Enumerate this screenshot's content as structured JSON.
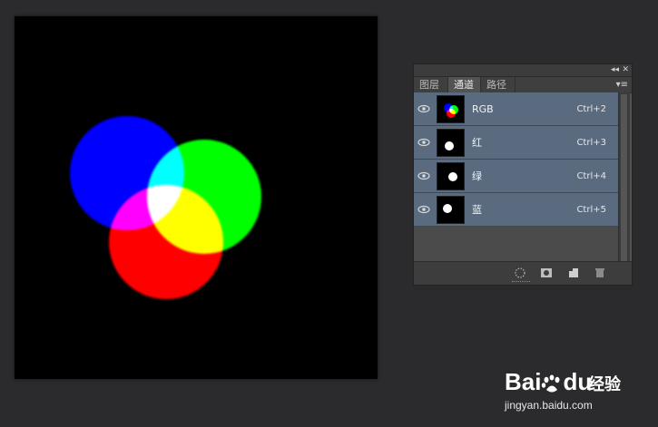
{
  "canvas": {
    "background": "#000000",
    "circles": [
      {
        "name": "blue-circle",
        "color": "#0000ff"
      },
      {
        "name": "green-circle",
        "color": "#00ff00"
      },
      {
        "name": "red-circle",
        "color": "#ff0000"
      }
    ]
  },
  "panel": {
    "controls": {
      "collapse": "◂◂",
      "close": "✕"
    },
    "tabs": [
      {
        "label": "图层",
        "active": false
      },
      {
        "label": "通道",
        "active": true
      },
      {
        "label": "路径",
        "active": false
      }
    ],
    "menu_icon": "▾≡",
    "channels": [
      {
        "name": "RGB",
        "shortcut": "Ctrl+2",
        "icon": "eye-icon"
      },
      {
        "name": "红",
        "shortcut": "Ctrl+3",
        "icon": "eye-icon"
      },
      {
        "name": "绿",
        "shortcut": "Ctrl+4",
        "icon": "eye-icon"
      },
      {
        "name": "蓝",
        "shortcut": "Ctrl+5",
        "icon": "eye-icon"
      }
    ],
    "bottom_tools": [
      "load-channel-as-selection-icon",
      "save-selection-as-channel-icon",
      "new-channel-icon",
      "delete-channel-icon"
    ],
    "row_color": "#5a6b80"
  },
  "watermark": {
    "brand": "Bai",
    "brand2": "du",
    "cn": "经验",
    "url": "jingyan.baidu.com"
  }
}
